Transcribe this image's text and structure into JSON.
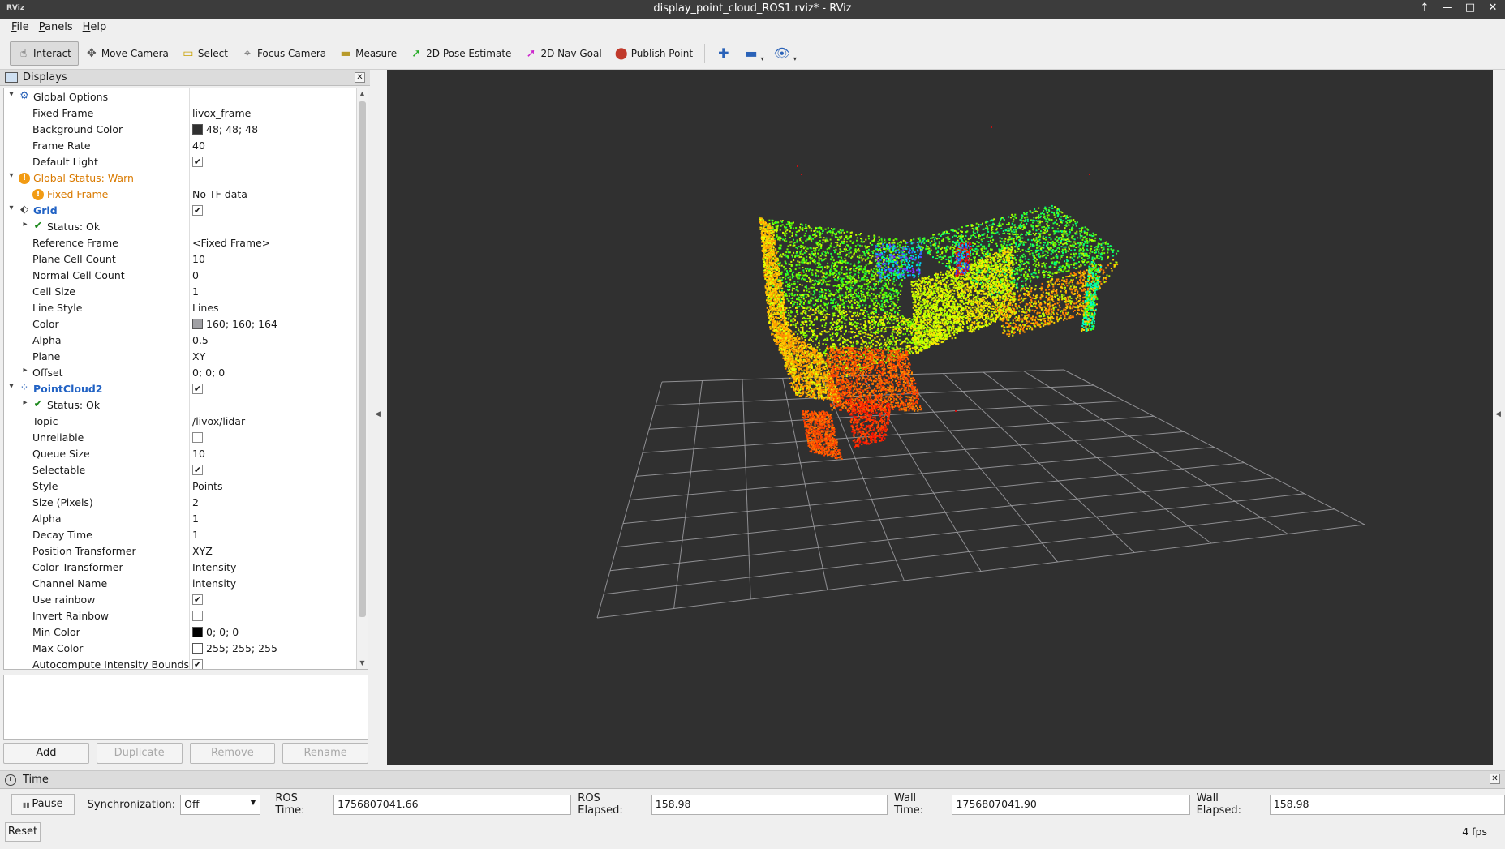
{
  "window": {
    "app_icon": "RViz",
    "title": "display_point_cloud_ROS1.rviz* - RViz",
    "controls": [
      "↑",
      "—",
      "□",
      "✕"
    ]
  },
  "menu": [
    "File",
    "Panels",
    "Help"
  ],
  "toolbar": {
    "tools": [
      {
        "label": "Interact",
        "icon": "hand-icon",
        "glyph": "☝",
        "color": "#333333",
        "active": true
      },
      {
        "label": "Move Camera",
        "icon": "move-camera-icon",
        "glyph": "✥",
        "color": "#555555"
      },
      {
        "label": "Select",
        "icon": "select-icon",
        "glyph": "▭",
        "color": "#c8a000"
      },
      {
        "label": "Focus Camera",
        "icon": "focus-camera-icon",
        "glyph": "⌖",
        "color": "#555555"
      },
      {
        "label": "Measure",
        "icon": "ruler-icon",
        "glyph": "▬",
        "color": "#b89a2a"
      },
      {
        "label": "2D Pose Estimate",
        "icon": "pose-arrow-icon",
        "glyph": "➚",
        "color": "#22aa22"
      },
      {
        "label": "2D Nav Goal",
        "icon": "nav-arrow-icon",
        "glyph": "➚",
        "color": "#cc22cc"
      },
      {
        "label": "Publish Point",
        "icon": "map-pin-icon",
        "glyph": "⬤",
        "color": "#c0392b"
      }
    ],
    "view": {
      "plus": "✚",
      "minus": "▬",
      "eye": "👁"
    }
  },
  "displays": {
    "title": "Displays",
    "rows": [
      {
        "level": 0,
        "arrow": "▾",
        "icon": "gear-icon",
        "glyph": "⚙",
        "icon_color": "#2a62b8",
        "name": "Global Options",
        "style": ""
      },
      {
        "level": 1,
        "name": "Fixed Frame",
        "value": "livox_frame"
      },
      {
        "level": 1,
        "name": "Background Color",
        "value": "48; 48; 48",
        "swatch": "#303030"
      },
      {
        "level": 1,
        "name": "Frame Rate",
        "value": "40"
      },
      {
        "level": 1,
        "name": "Default Light",
        "check": true
      },
      {
        "level": 0,
        "arrow": "▾",
        "icon": "warning-icon",
        "glyph": "!",
        "warn": true,
        "name": "Global Status: Warn",
        "style": "warn"
      },
      {
        "level": 1,
        "icon": "warning-icon",
        "glyph": "!",
        "warn": true,
        "name": "Fixed Frame",
        "value": "No TF data",
        "style": "warn"
      },
      {
        "level": 0,
        "arrow": "▾",
        "icon": "grid-icon",
        "glyph": "⬖",
        "icon_color": "#444444",
        "name": "Grid",
        "style": "bold-blue",
        "check": true
      },
      {
        "level": 1,
        "arrow": "▸",
        "icon": "checkmark-icon",
        "glyph": "✔",
        "ok": true,
        "name": "Status: Ok"
      },
      {
        "level": 1,
        "name": "Reference Frame",
        "value": "<Fixed Frame>"
      },
      {
        "level": 1,
        "name": "Plane Cell Count",
        "value": "10"
      },
      {
        "level": 1,
        "name": "Normal Cell Count",
        "value": "0"
      },
      {
        "level": 1,
        "name": "Cell Size",
        "value": "1"
      },
      {
        "level": 1,
        "name": "Line Style",
        "value": "Lines"
      },
      {
        "level": 1,
        "name": "Color",
        "value": "160; 160; 164",
        "swatch": "#a0a0a4"
      },
      {
        "level": 1,
        "name": "Alpha",
        "value": "0.5"
      },
      {
        "level": 1,
        "name": "Plane",
        "value": "XY"
      },
      {
        "level": 1,
        "arrow": "▸",
        "name": "Offset",
        "value": "0; 0; 0"
      },
      {
        "level": 0,
        "arrow": "▾",
        "icon": "point-cloud-icon",
        "glyph": "⁘",
        "icon_color": "#2a62b8",
        "name": "PointCloud2",
        "style": "bold-blue",
        "check": true
      },
      {
        "level": 1,
        "arrow": "▸",
        "icon": "checkmark-icon",
        "glyph": "✔",
        "ok": true,
        "name": "Status: Ok"
      },
      {
        "level": 1,
        "name": "Topic",
        "value": "/livox/lidar"
      },
      {
        "level": 1,
        "name": "Unreliable",
        "check": false
      },
      {
        "level": 1,
        "name": "Queue Size",
        "value": "10"
      },
      {
        "level": 1,
        "name": "Selectable",
        "check": true
      },
      {
        "level": 1,
        "name": "Style",
        "value": "Points"
      },
      {
        "level": 1,
        "name": "Size (Pixels)",
        "value": "2"
      },
      {
        "level": 1,
        "name": "Alpha",
        "value": "1"
      },
      {
        "level": 1,
        "name": "Decay Time",
        "value": "1"
      },
      {
        "level": 1,
        "name": "Position Transformer",
        "value": "XYZ"
      },
      {
        "level": 1,
        "name": "Color Transformer",
        "value": "Intensity"
      },
      {
        "level": 1,
        "name": "Channel Name",
        "value": "intensity"
      },
      {
        "level": 1,
        "name": "Use rainbow",
        "check": true
      },
      {
        "level": 1,
        "name": "Invert Rainbow",
        "check": false
      },
      {
        "level": 1,
        "name": "Min Color",
        "value": "0; 0; 0",
        "swatch": "#000000"
      },
      {
        "level": 1,
        "name": "Max Color",
        "value": "255; 255; 255",
        "swatch": "#ffffff"
      },
      {
        "level": 1,
        "name": "Autocompute Intensity Bounds",
        "check": true
      }
    ],
    "buttons": [
      {
        "label": "Add",
        "enabled": true
      },
      {
        "label": "Duplicate",
        "enabled": false
      },
      {
        "label": "Remove",
        "enabled": false
      },
      {
        "label": "Rename",
        "enabled": false
      }
    ]
  },
  "viewport": {
    "background": "#303030",
    "grid_color": "#a0a0a4"
  },
  "time": {
    "title": "Time",
    "pause_label": "Pause",
    "sync_label": "Synchronization:",
    "sync_value": "Off",
    "ros_time_label": "ROS Time:",
    "ros_time": "1756807041.66",
    "ros_elapsed_label": "ROS Elapsed:",
    "ros_elapsed": "158.98",
    "wall_time_label": "Wall Time:",
    "wall_time": "1756807041.90",
    "wall_elapsed_label": "Wall Elapsed:",
    "wall_elapsed": "158.98",
    "reset_label": "Reset",
    "fps": "4 fps"
  }
}
